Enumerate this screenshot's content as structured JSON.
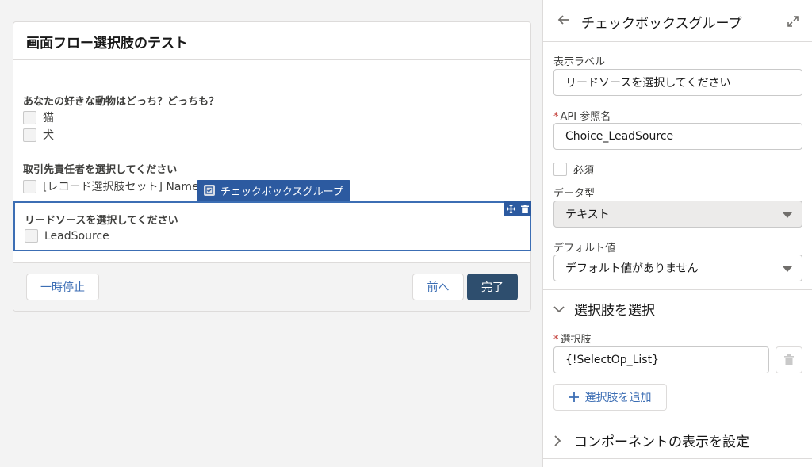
{
  "screen": {
    "card_title": "画面フロー選択肢のテスト",
    "q1_label": "あなたの好きな動物はどっち？どっちも？",
    "q1_options": [
      "猫",
      "犬"
    ],
    "q2_label": "取引先責任者を選択してください",
    "q2_option": "[レコード選択肢セット] Name",
    "component_tag": "チェックボックスグループ",
    "q3_label": "リードソースを選択してください",
    "q3_option": "LeadSource",
    "pause_button": "一時停止",
    "prev_button": "前へ",
    "finish_button": "完了"
  },
  "panel": {
    "title": "チェックボックスグループ",
    "display_label_label": "表示ラベル",
    "display_label_value": "リードソースを選択してください",
    "api_name_label": "API 参照名",
    "api_name_value": "Choice_LeadSource",
    "required_label": "必須",
    "data_type_label": "データ型",
    "data_type_value": "テキスト",
    "default_value_label": "デフォルト値",
    "default_value_value": "デフォルト値がありません",
    "choices_section": "選択肢を選択",
    "choice_label": "選択肢",
    "choice_value": "{!SelectOp_List}",
    "add_choice_button": "選択肢を追加",
    "visibility_section": "コンポーネントの表示を設定"
  },
  "colors": {
    "brand_blue": "#2c5aa0",
    "selection_border": "#3c6eb4",
    "finish_button": "#2e4e6e",
    "required_star": "#c23934"
  },
  "icons": [
    "back-arrow-icon",
    "expand-icon",
    "checkbox-group-icon",
    "move-icon",
    "delete-icon",
    "chevron-down-icon",
    "chevron-right-icon",
    "plus-icon",
    "trash-icon"
  ]
}
